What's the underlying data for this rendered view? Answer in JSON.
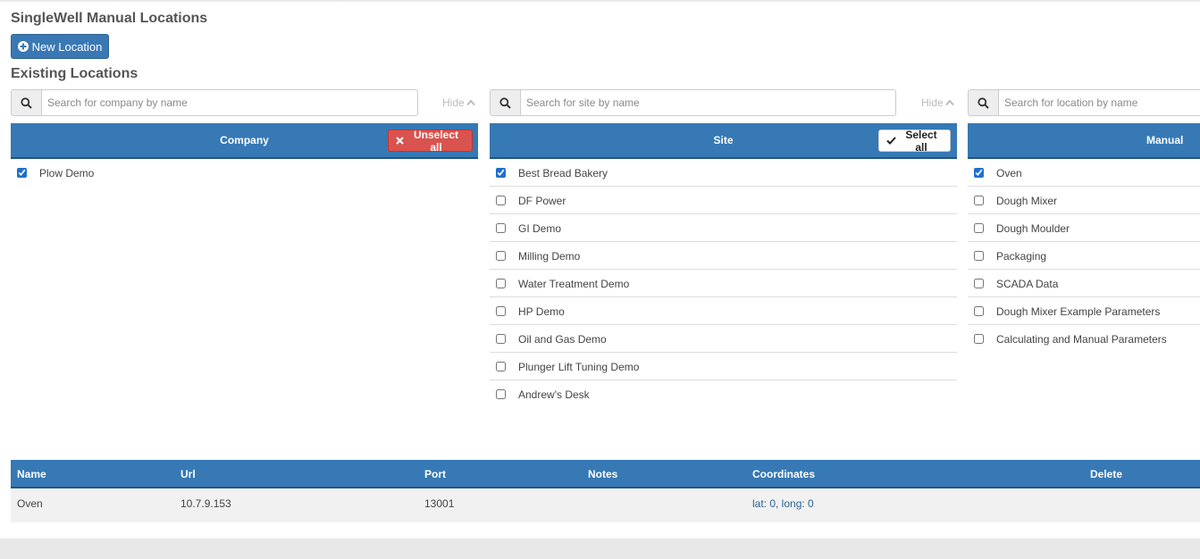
{
  "page": {
    "title": "SingleWell Manual Locations",
    "new_location_label": "New Location",
    "existing_title": "Existing Locations"
  },
  "company": {
    "search_placeholder": "Search for company by name",
    "hide_label": "Hide",
    "header": "Company",
    "action_label": "Unselect all",
    "items": [
      {
        "label": "Plow Demo",
        "checked": true
      }
    ]
  },
  "site": {
    "search_placeholder": "Search for site by name",
    "hide_label": "Hide",
    "header": "Site",
    "action_label": "Select all",
    "items": [
      {
        "label": "Best Bread Bakery",
        "checked": true
      },
      {
        "label": "DF Power",
        "checked": false
      },
      {
        "label": "GI Demo",
        "checked": false
      },
      {
        "label": "Milling Demo",
        "checked": false
      },
      {
        "label": "Water Treatment Demo",
        "checked": false
      },
      {
        "label": "HP Demo",
        "checked": false
      },
      {
        "label": "Oil and Gas Demo",
        "checked": false
      },
      {
        "label": "Plunger Lift Tuning Demo",
        "checked": false
      },
      {
        "label": "Andrew's Desk",
        "checked": false
      }
    ]
  },
  "manual": {
    "search_placeholder": "Search for location by name",
    "header": "Manual",
    "items": [
      {
        "label": "Oven",
        "checked": true
      },
      {
        "label": "Dough Mixer",
        "checked": false
      },
      {
        "label": "Dough Moulder",
        "checked": false
      },
      {
        "label": "Packaging",
        "checked": false
      },
      {
        "label": "SCADA Data",
        "checked": false
      },
      {
        "label": "Dough Mixer Example Parameters",
        "checked": false
      },
      {
        "label": "Calculating and Manual Parameters",
        "checked": false
      }
    ]
  },
  "table": {
    "headers": {
      "name": "Name",
      "url": "Url",
      "port": "Port",
      "notes": "Notes",
      "coordinates": "Coordinates",
      "delete": "Delete"
    },
    "rows": [
      {
        "name": "Oven",
        "url": "10.7.9.153",
        "port": "13001",
        "notes": "",
        "coordinates": "lat: 0, long: 0"
      }
    ]
  },
  "colors": {
    "header_blue": "#3679b5",
    "danger_red": "#d9534f",
    "link_blue": "#2a6496"
  }
}
